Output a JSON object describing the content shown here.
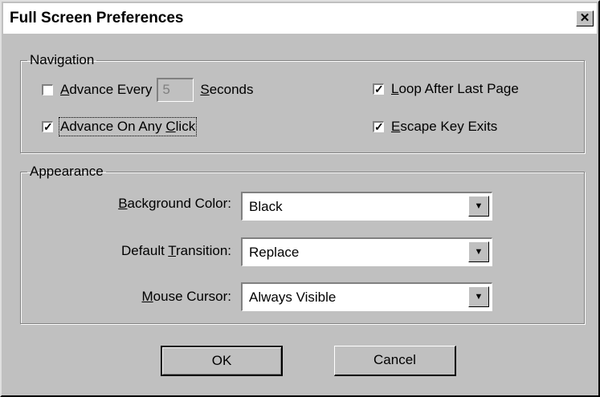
{
  "window": {
    "title": "Full Screen Preferences",
    "close_glyph": "✕"
  },
  "navigation": {
    "legend": "Navigation",
    "advance_every": {
      "mnemonic": "A",
      "label_rest": "dvance Every",
      "seconds_value": "5",
      "seconds_mnemonic": "S",
      "seconds_rest": "econds",
      "checked": false
    },
    "advance_click": {
      "label_pre": "Advance On Any ",
      "mnemonic": "C",
      "label_rest": "lick",
      "checked": true
    },
    "loop": {
      "mnemonic": "L",
      "label_rest": "oop After Last Page",
      "checked": true
    },
    "escape": {
      "mnemonic": "E",
      "label_rest": "scape Key Exits",
      "checked": true
    },
    "check_glyph": "✓"
  },
  "appearance": {
    "legend": "Appearance",
    "background": {
      "mnemonic": "B",
      "label_rest": "ackground Color:",
      "value": "Black"
    },
    "transition": {
      "label_pre": "Default ",
      "mnemonic": "T",
      "label_rest": "ransition:",
      "value": "Replace"
    },
    "cursor": {
      "mnemonic": "M",
      "label_rest": "ouse Cursor:",
      "value": "Always Visible"
    },
    "arrow_glyph": "▼"
  },
  "buttons": {
    "ok": "OK",
    "cancel": "Cancel"
  }
}
